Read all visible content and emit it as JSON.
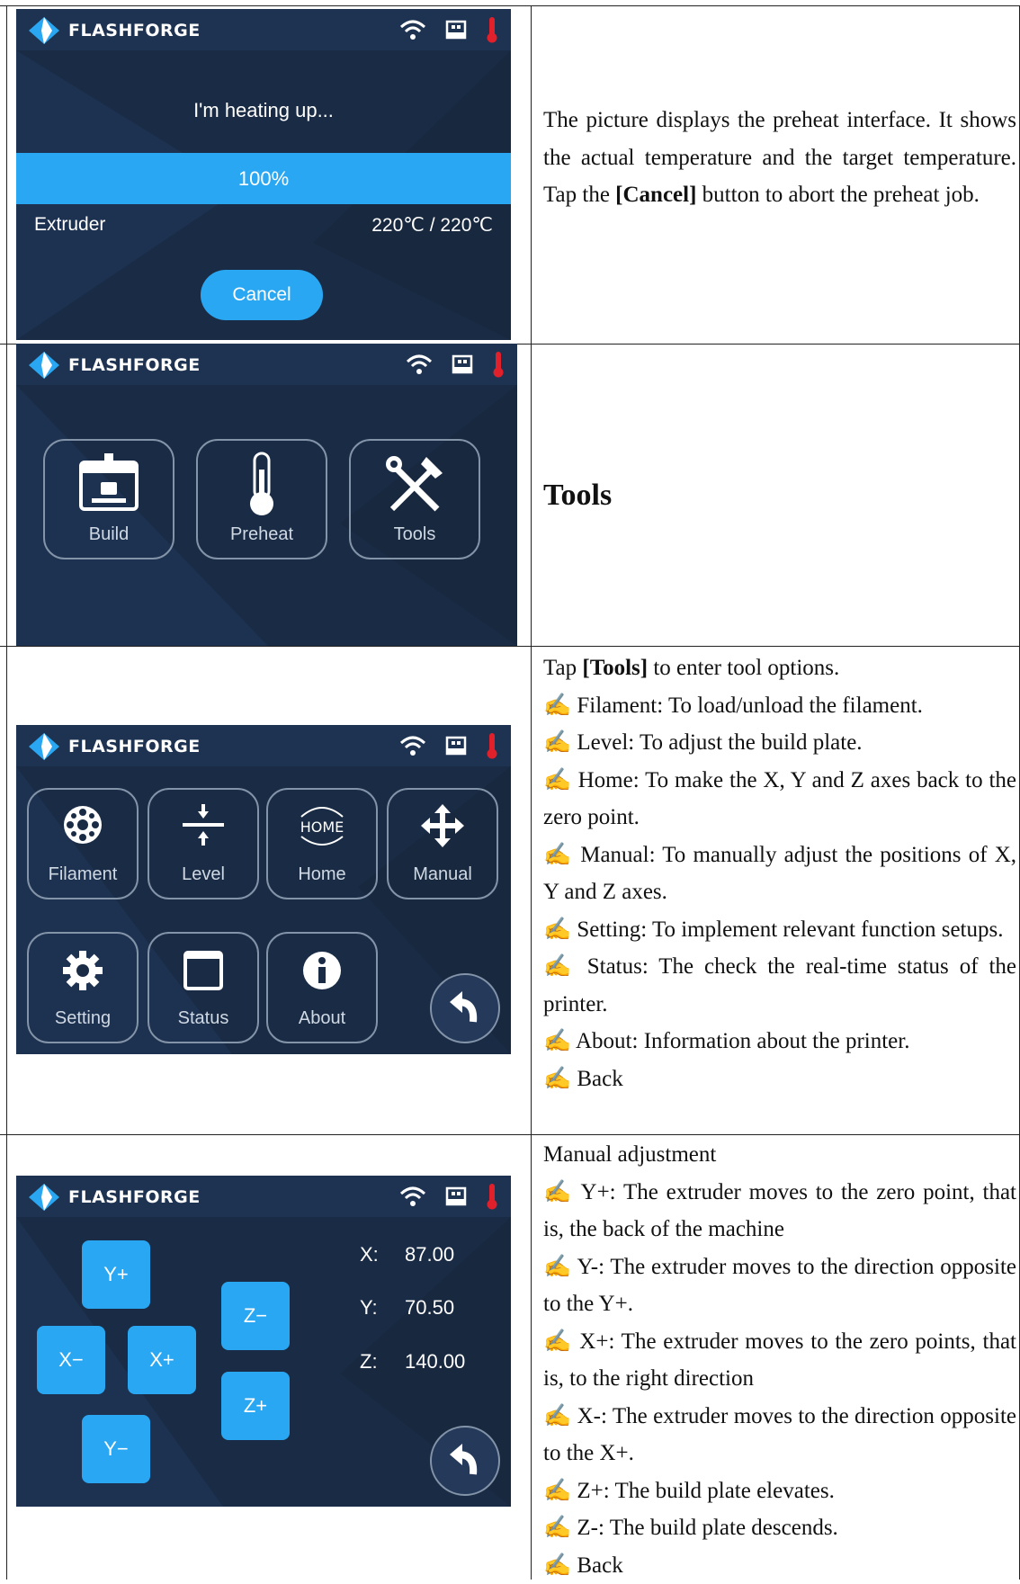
{
  "brand": "FLASHFORGE",
  "colors": {
    "accent": "#2aa7f2",
    "panel": "#1a2c45",
    "thermo": "#e0202a"
  },
  "icons": [
    "wifi-icon",
    "usb-icon",
    "thermometer-icon",
    "back-arrow-icon"
  ],
  "row1": {
    "screen": {
      "title": "I'm heating up...",
      "progress": "100%",
      "progress_value": 1.0,
      "extruder_label": "Extruder",
      "extruder_value": "220℃ / 220℃",
      "cancel": "Cancel"
    },
    "desc_pre": "The picture displays the preheat interface. It shows the actual temperature and the target temperature. Tap the ",
    "desc_bold": "[Cancel]",
    "desc_post": " button to abort the preheat job."
  },
  "row2": {
    "screen": {
      "build": "Build",
      "preheat": "Preheat",
      "tools": "Tools"
    },
    "heading": "Tools"
  },
  "row3": {
    "screen": {
      "filament": "Filament",
      "level": "Level",
      "home": "Home",
      "home_icon_text": "HOME",
      "manual": "Manual",
      "setting": "Setting",
      "status": "Status",
      "about": "About"
    },
    "intro_pre": "Tap ",
    "intro_bold": "[Tools]",
    "intro_post": " to enter tool options.",
    "items": [
      "✍ Filament: To load/unload the filament.",
      "✍ Level: To adjust the build plate.",
      "✍ Home: To make the X, Y and Z axes back to the zero point.",
      "✍ Manual: To manually adjust the positions of X, Y and Z axes.",
      "✍ Setting: To implement relevant function setups.",
      "✍ Status: The check the real-time status of the printer.",
      "✍ About: Information about the printer.",
      "✍ Back"
    ]
  },
  "row4": {
    "screen": {
      "yplus": "Y+",
      "yminus": "Y−",
      "xminus": "X−",
      "xplus": "X+",
      "zminus": "Z−",
      "zplus": "Z+",
      "x_label": "X:",
      "x_value": "87.00",
      "y_label": "Y:",
      "y_value": "70.50",
      "z_label": "Z:",
      "z_value": "140.00"
    },
    "intro": "Manual adjustment",
    "items": [
      "✍ Y+: The extruder moves to the zero point, that is, the back of the machine",
      "✍ Y-: The extruder moves to the direction opposite to the Y+.",
      "✍ X+: The extruder moves to the zero points, that is, to the right direction",
      "✍ X-: The extruder moves to the direction opposite to the X+.",
      "✍ Z+: The build plate elevates.",
      "✍ Z-: The build plate descends.",
      "✍ Back"
    ]
  }
}
